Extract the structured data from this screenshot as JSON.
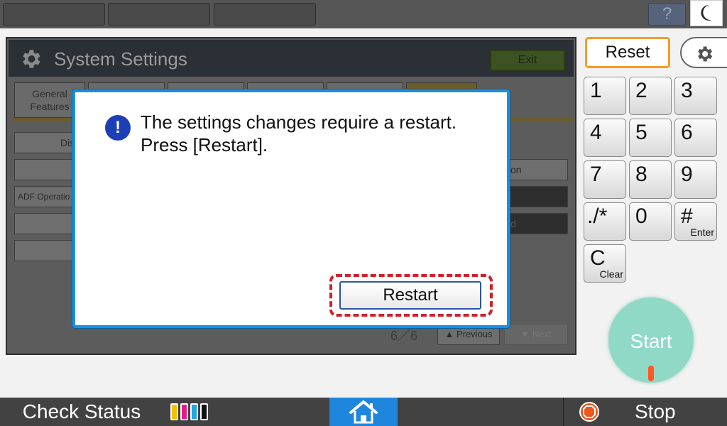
{
  "topbar": {
    "help_label": "?"
  },
  "panel": {
    "title": "System Settings",
    "exit_label": "Exit",
    "tabs": [
      "General Features",
      "",
      "",
      "",
      "",
      ""
    ],
    "buttons": {
      "display_partial": "Dis",
      "adf_partial": "ADF Operatio",
      "right_partial_1": "on",
      "right_partial_3": "d"
    },
    "page_indicator": "6／6",
    "previous_label": "Previous",
    "next_label": "Next"
  },
  "dialog": {
    "message_line1": "The settings changes require a restart.",
    "message_line2": "Press [Restart].",
    "restart_label": "Restart"
  },
  "keypad": {
    "reset_label": "Reset",
    "keys": [
      {
        "main": "1",
        "sub": ""
      },
      {
        "main": "2",
        "sub": ""
      },
      {
        "main": "3",
        "sub": ""
      },
      {
        "main": "4",
        "sub": ""
      },
      {
        "main": "5",
        "sub": ""
      },
      {
        "main": "6",
        "sub": ""
      },
      {
        "main": "7",
        "sub": ""
      },
      {
        "main": "8",
        "sub": ""
      },
      {
        "main": "9",
        "sub": ""
      },
      {
        "main": "./*",
        "sub": ""
      },
      {
        "main": "0",
        "sub": ""
      },
      {
        "main": "#",
        "sub": "Enter"
      },
      {
        "main": "C",
        "sub": "Clear"
      }
    ],
    "start_label": "Start"
  },
  "bottombar": {
    "check_status_label": "Check Status",
    "stop_label": "Stop",
    "toner_colors": [
      "#f2c200",
      "#e8198c",
      "#1fa7e0",
      "#111111"
    ]
  }
}
